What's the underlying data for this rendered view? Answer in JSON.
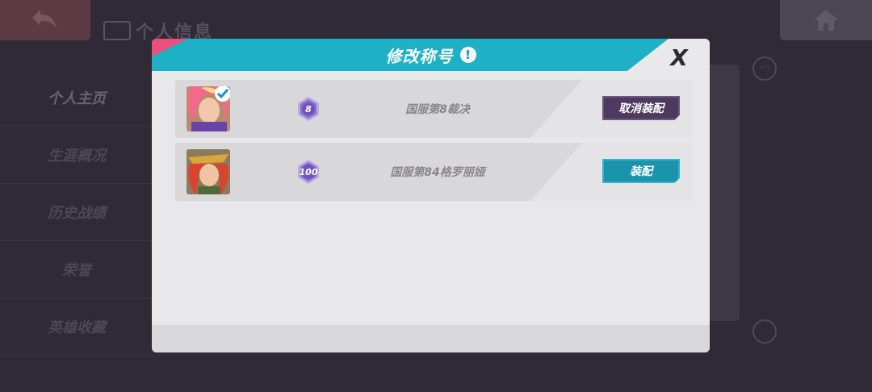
{
  "background": {
    "page_title": "个人信息",
    "sidebar_items": [
      {
        "label": "个人主页",
        "active": true
      },
      {
        "label": "生涯概况",
        "active": false
      },
      {
        "label": "历史战绩",
        "active": false
      },
      {
        "label": "荣誉",
        "active": false
      },
      {
        "label": "英雄收藏",
        "active": false
      }
    ],
    "more_glyph": "···"
  },
  "modal": {
    "title": "修改称号",
    "info_glyph": "!",
    "close_glyph": "X",
    "titles": [
      {
        "rank_badge": "8",
        "title_text": "国服第8裁决",
        "action_label": "取消装配",
        "equipped": true,
        "hero": "hero-avatar-pink-hair"
      },
      {
        "rank_badge": "100",
        "title_text": "国服第84格罗丽娅",
        "action_label": "装配",
        "equipped": false,
        "hero": "hero-avatar-red-hair"
      }
    ]
  },
  "colors": {
    "header_teal": "#1eb1c6",
    "accent_pink": "#ec4f7b",
    "unequip_button": "#4e3a5e",
    "equip_button": "#1a93ac",
    "badge_purple": "#8b6fd0"
  }
}
